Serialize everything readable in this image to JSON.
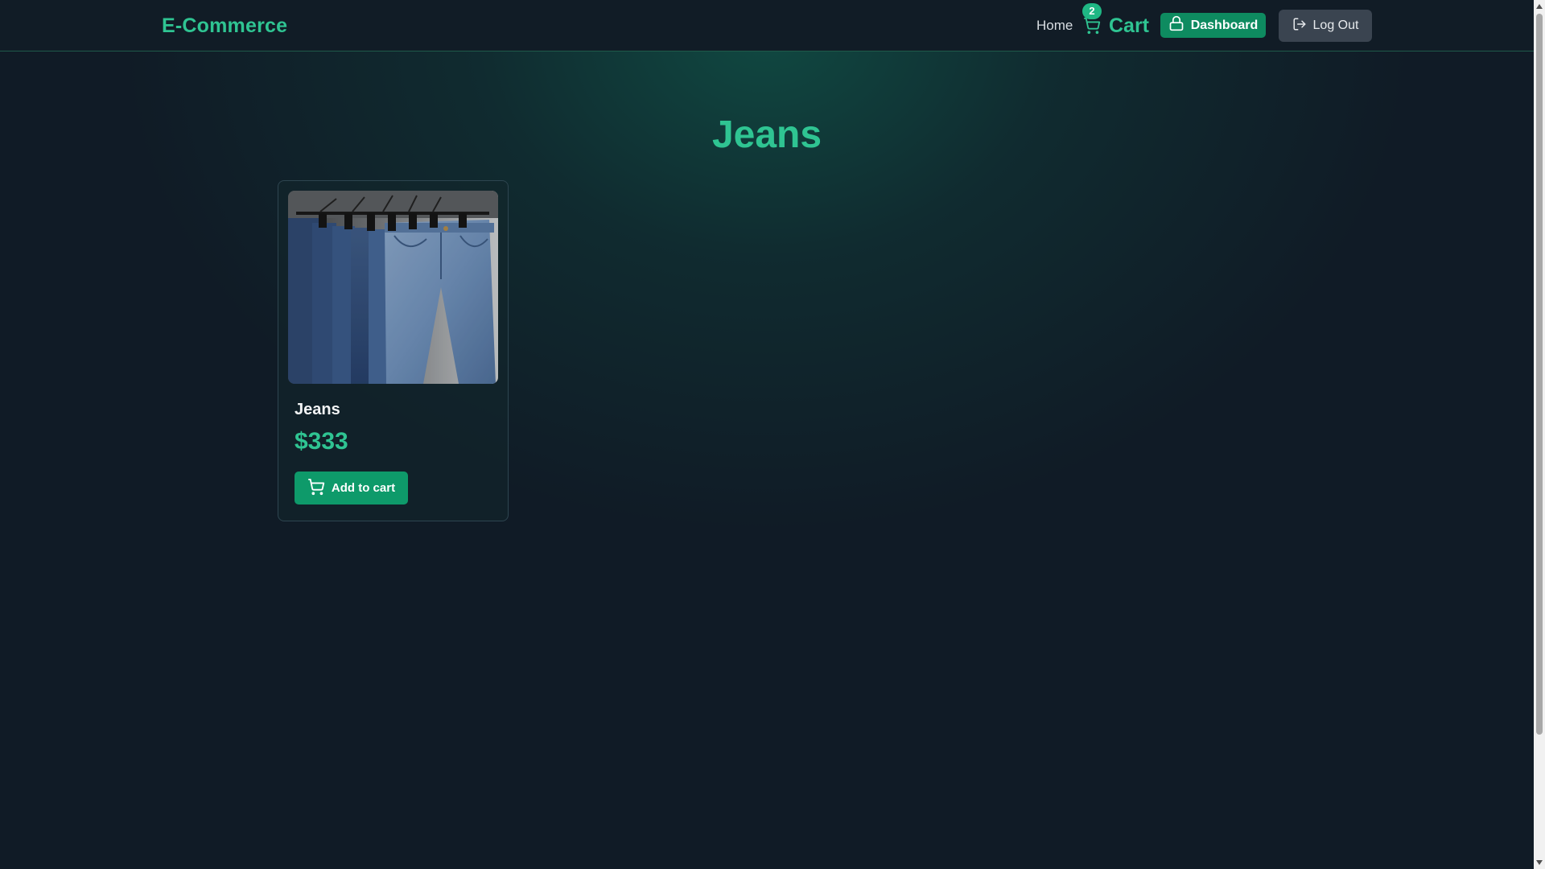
{
  "header": {
    "brand": "E-Commerce",
    "nav": {
      "home_label": "Home",
      "cart_label": "Cart",
      "cart_count": "2",
      "dashboard_label": "Dashboard",
      "logout_label": "Log Out"
    }
  },
  "main": {
    "title": "Jeans",
    "products": [
      {
        "name": "Jeans",
        "price": "$333",
        "add_to_cart_label": "Add to cart",
        "image": "jeans-photo"
      }
    ]
  },
  "colors": {
    "accent": "#2fc492",
    "primary_button": "#0e8b60",
    "background": "#101b26",
    "secondary_button": "#3a4450"
  },
  "icons": {
    "cart": "shopping-cart-icon",
    "dashboard": "lock-icon",
    "logout": "log-out-icon"
  }
}
